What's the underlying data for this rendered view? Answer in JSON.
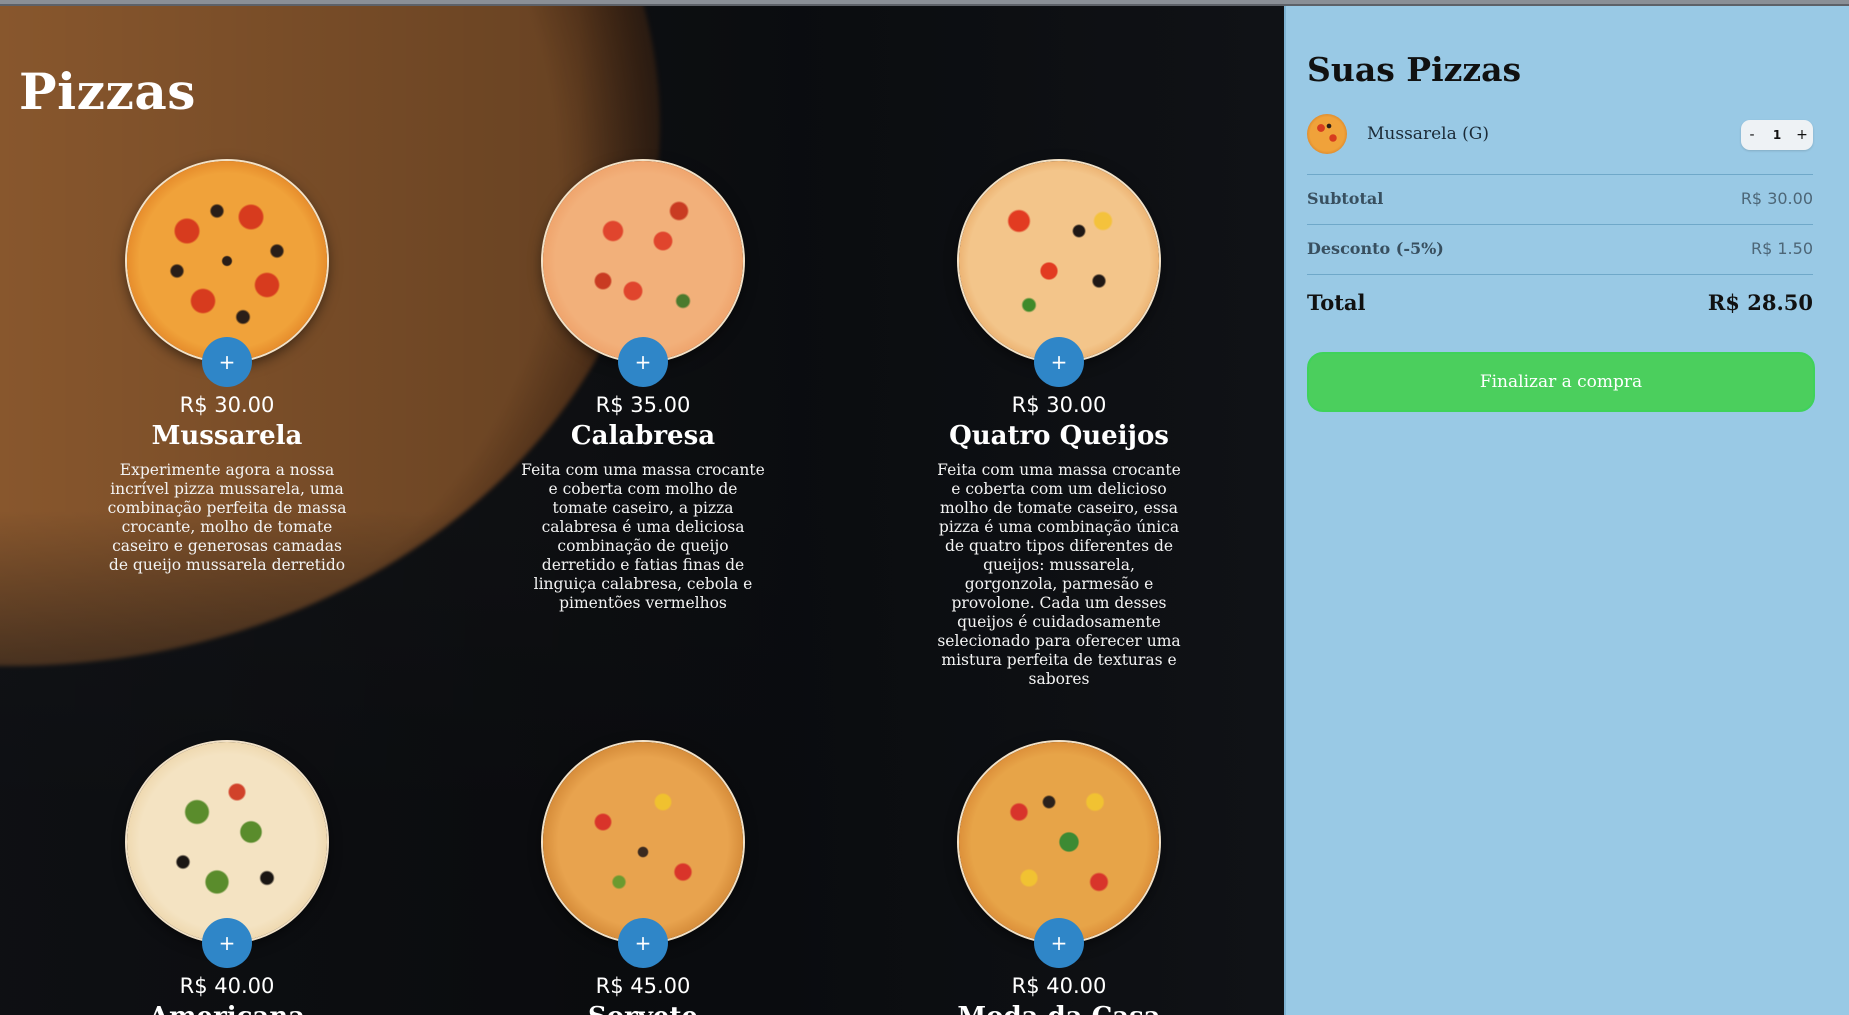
{
  "menu": {
    "title": "Pizzas",
    "add_label": "+",
    "items": [
      {
        "price": "R$ 30.00",
        "name": "Mussarela",
        "description": "Experimente agora a nossa incrível pizza mussarela, uma combinação perfeita de massa crocante, molho de tomate caseiro e generosas camadas de queijo mussarela derretido"
      },
      {
        "price": "R$ 35.00",
        "name": "Calabresa",
        "description": "Feita com uma massa crocante e coberta com molho de tomate caseiro, a pizza calabresa é uma deliciosa combinação de queijo derretido e fatias finas de linguiça calabresa, cebola e pimentões vermelhos"
      },
      {
        "price": "R$ 30.00",
        "name": "Quatro Queijos",
        "description": "Feita com uma massa crocante e coberta com um delicioso molho de tomate caseiro, essa pizza é uma combinação única de quatro tipos diferentes de queijos: mussarela, gorgonzola, parmesão e provolone. Cada um desses queijos é cuidadosamente selecionado para oferecer uma mistura perfeita de texturas e sabores"
      },
      {
        "price": "R$ 40.00",
        "name": "Americana",
        "description": ""
      },
      {
        "price": "R$ 45.00",
        "name": "Sorvete",
        "description": ""
      },
      {
        "price": "R$ 40.00",
        "name": "Moda da Casa",
        "description": ""
      }
    ]
  },
  "cart": {
    "title": "Suas Pizzas",
    "items": [
      {
        "name": "Mussarela (G)",
        "quantity": "1",
        "minus": "-",
        "plus": "+"
      }
    ],
    "subtotal_label": "Subtotal",
    "subtotal_value": "R$ 30.00",
    "discount_label": "Desconto (-5%)",
    "discount_value": "R$ 1.50",
    "total_label": "Total",
    "total_value": "R$ 28.50",
    "checkout_label": "Finalizar a compra"
  },
  "colors": {
    "cart_bg": "#99c9e5",
    "add_button": "#2f86c8",
    "checkout_button": "#4bcf5d"
  }
}
